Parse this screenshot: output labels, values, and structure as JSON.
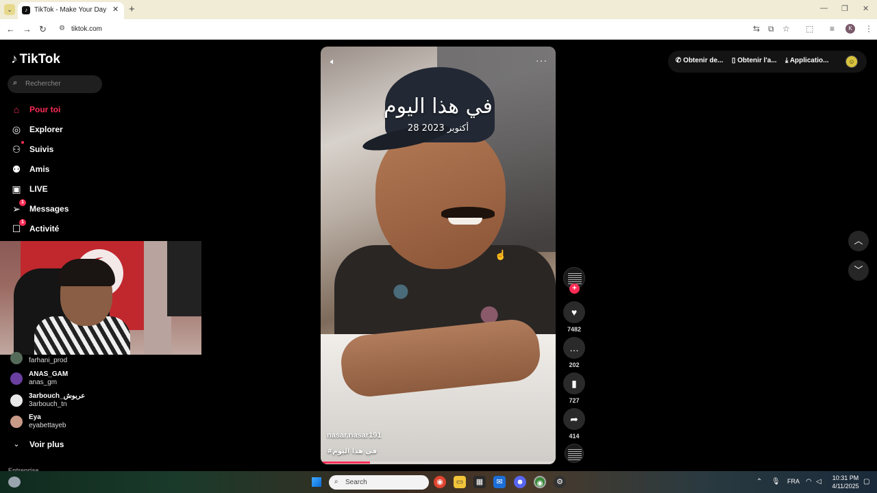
{
  "browser": {
    "tab_title": "TikTok - Make Your Day",
    "tab_favicon": "tiktok-favicon",
    "url": "tiktok.com",
    "profile_initial": "K"
  },
  "tiktok": {
    "logo_text": "TikTok",
    "search_placeholder": "Rechercher",
    "nav": [
      {
        "label": "Pour toi",
        "icon": "home-icon",
        "active": true
      },
      {
        "label": "Explorer",
        "icon": "compass-icon"
      },
      {
        "label": "Suivis",
        "icon": "following-icon"
      },
      {
        "label": "Amis",
        "icon": "friends-icon"
      },
      {
        "label": "LIVE",
        "icon": "live-icon"
      },
      {
        "label": "Messages",
        "icon": "messages-icon",
        "badge": "1"
      },
      {
        "label": "Activité",
        "icon": "activity-icon",
        "badge": "1"
      }
    ],
    "following": [
      {
        "name": "",
        "handle": "farhani_prod"
      },
      {
        "name": "ANAS_GAM",
        "handle": "anas_gm"
      },
      {
        "name": "3arbouch_عربوش",
        "handle": "3arbouch_tn"
      },
      {
        "name": "Eya",
        "handle": "eyabettayeb"
      }
    ],
    "see_more": "Voir plus",
    "footer_heading": "Entreprise",
    "top_buttons": [
      "Obtenir de...",
      "Obtenir l'a...",
      "Applicatio..."
    ],
    "video": {
      "overlay_title": "في هذا اليوم",
      "overlay_date": "28 أكتوبر 2023",
      "author": "nasar.nasar191",
      "caption": "#في هذا اليوم",
      "progress": 0.21
    },
    "actions": {
      "likes": "7482",
      "comments": "202",
      "saves": "727",
      "shares": "414"
    }
  },
  "taskbar": {
    "search_placeholder": "Search",
    "language": "FRA",
    "time": "10:31 PM",
    "date": "4/11/2025",
    "apps": [
      "chrome-icon",
      "file-explorer-icon",
      "store-icon",
      "outlook-icon",
      "discord-icon",
      "chrome-active-icon",
      "steam-icon"
    ]
  },
  "colors": {
    "accent": "#fe2c55",
    "background": "#000000"
  }
}
